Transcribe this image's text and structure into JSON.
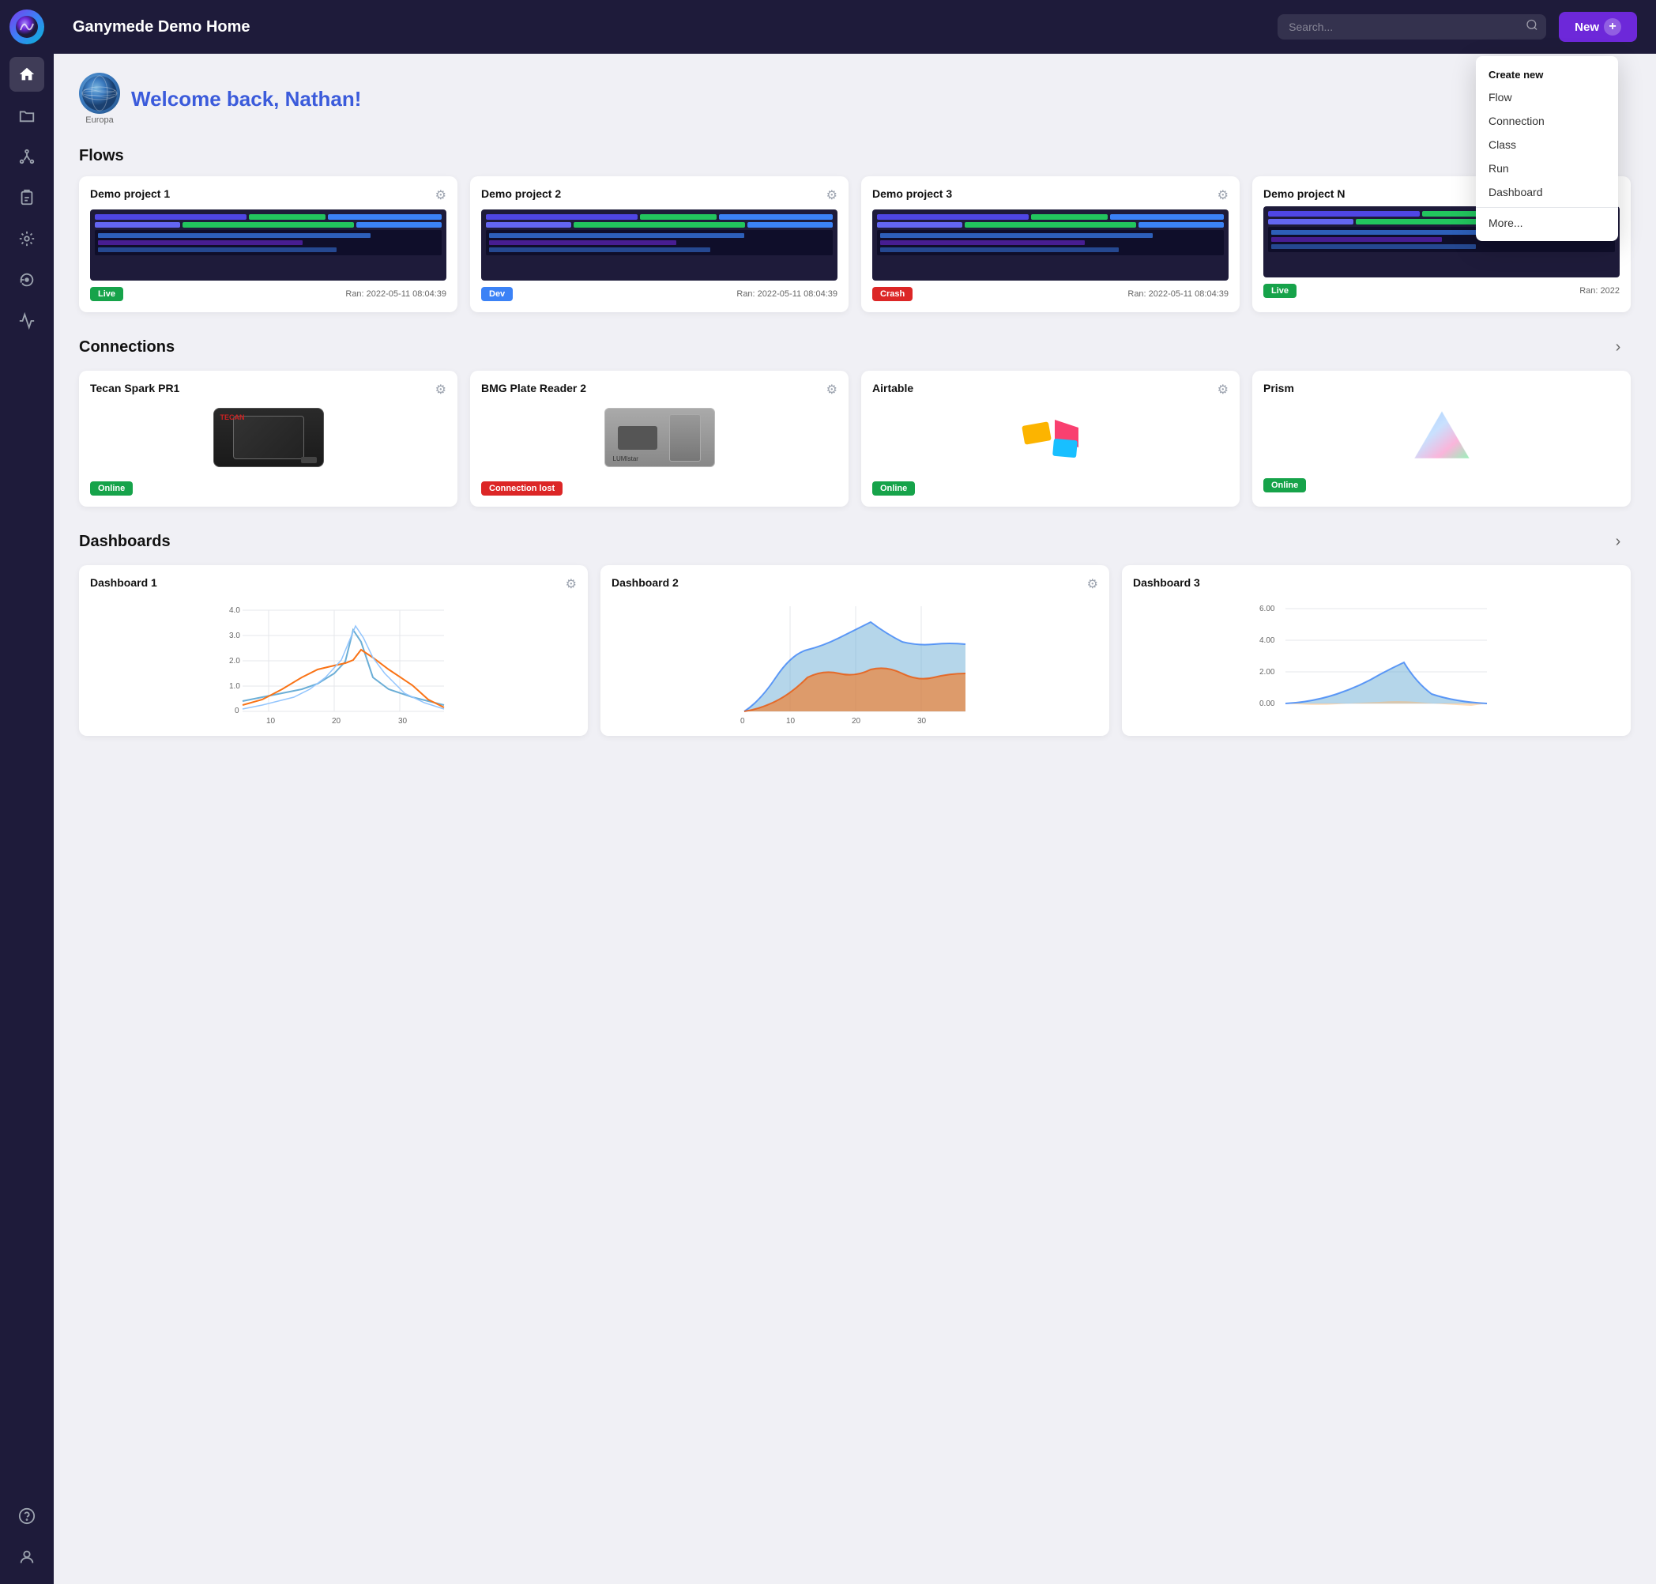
{
  "app": {
    "title": "Ganymede Demo Home"
  },
  "header": {
    "search_placeholder": "Search...",
    "new_button_label": "New"
  },
  "dropdown": {
    "header": "Create new",
    "items": [
      "Flow",
      "Connection",
      "Class",
      "Run",
      "Dashboard",
      "More..."
    ]
  },
  "welcome": {
    "text": "Welcome back, Nathan!",
    "avatar_label": "Europa"
  },
  "flows": {
    "section_title": "Flows",
    "cards": [
      {
        "title": "Demo project 1",
        "status": "Live",
        "status_type": "live",
        "ran": "Ran: 2022-05-11 08:04:39"
      },
      {
        "title": "Demo project 2",
        "status": "Dev",
        "status_type": "dev",
        "ran": "Ran: 2022-05-11 08:04:39"
      },
      {
        "title": "Demo project 3",
        "status": "Crash",
        "status_type": "crash",
        "ran": "Ran: 2022-05-11 08:04:39"
      },
      {
        "title": "Demo project N",
        "status": "Live",
        "status_type": "live",
        "ran": "Ran: 2022"
      }
    ]
  },
  "connections": {
    "section_title": "Connections",
    "cards": [
      {
        "title": "Tecan Spark PR1",
        "type": "tecan",
        "status": "Online",
        "status_type": "online"
      },
      {
        "title": "BMG Plate Reader 2",
        "type": "bmg",
        "status": "Connection lost",
        "status_type": "lost"
      },
      {
        "title": "Airtable",
        "type": "airtable",
        "status": "Online",
        "status_type": "online"
      },
      {
        "title": "Prism",
        "type": "prism",
        "status": "Online",
        "status_type": "online"
      }
    ]
  },
  "dashboards": {
    "section_title": "Dashboards",
    "cards": [
      {
        "title": "Dashboard 1",
        "type": "line"
      },
      {
        "title": "Dashboard 2",
        "type": "area"
      },
      {
        "title": "Dashboard 3",
        "type": "area2"
      }
    ]
  },
  "sidebar": {
    "items": [
      {
        "name": "home",
        "label": "Home",
        "active": true
      },
      {
        "name": "files",
        "label": "Files",
        "active": false
      },
      {
        "name": "network",
        "label": "Network",
        "active": false
      },
      {
        "name": "clipboard",
        "label": "Clipboard",
        "active": false
      },
      {
        "name": "tools",
        "label": "Tools",
        "active": false
      },
      {
        "name": "refresh",
        "label": "Refresh",
        "active": false
      },
      {
        "name": "chart",
        "label": "Chart",
        "active": false
      }
    ],
    "bottom_items": [
      {
        "name": "help",
        "label": "Help"
      },
      {
        "name": "profile",
        "label": "Profile"
      }
    ]
  }
}
